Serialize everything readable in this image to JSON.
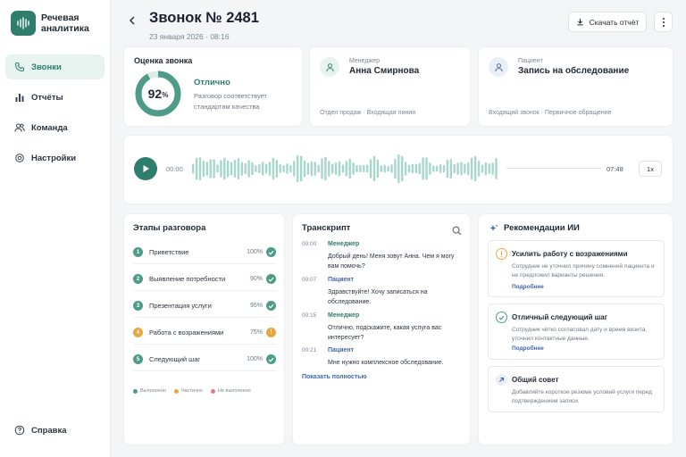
{
  "app": {
    "name": "Речевая аналитика"
  },
  "sidebar": {
    "items": [
      {
        "label": "Звонки",
        "icon": "phone-icon",
        "active": true
      },
      {
        "label": "Отчёты",
        "icon": "bar-chart-icon",
        "active": false
      },
      {
        "label": "Команда",
        "icon": "team-icon",
        "active": false
      },
      {
        "label": "Настройки",
        "icon": "gear-icon",
        "active": false
      }
    ],
    "help": {
      "label": "Справка",
      "icon": "help-icon"
    }
  },
  "header": {
    "title": "Звонок № 2481",
    "date": "23 января 2026 · 08:16",
    "download_label": "Скачать отчёт"
  },
  "score": {
    "title": "Оценка звонка",
    "value_number": "92",
    "value_unit": "%",
    "percent": 92,
    "label": "Отлично",
    "description": "Разговор соответствует стандартам качества"
  },
  "manager": {
    "role": "Менеджер",
    "name": "Анна Смирнова",
    "meta": "Отдел продаж · Входящая линия"
  },
  "patient": {
    "role": "Пациент",
    "name": "Запись на обследование",
    "meta": "Входящий звонок · Первичное обращение"
  },
  "player": {
    "current_time": "00:00",
    "duration": "07:48",
    "speed": "1x"
  },
  "stages": {
    "title": "Этапы разговора",
    "items": [
      {
        "num": "1",
        "label": "Приветствие",
        "percent": "100%",
        "status": "done"
      },
      {
        "num": "2",
        "label": "Выявление потребности",
        "percent": "90%",
        "status": "done"
      },
      {
        "num": "3",
        "label": "Презентация услуги",
        "percent": "95%",
        "status": "done"
      },
      {
        "num": "4",
        "label": "Работа с возражениями",
        "percent": "75%",
        "status": "partial"
      },
      {
        "num": "5",
        "label": "Следующий шаг",
        "percent": "100%",
        "status": "done"
      }
    ],
    "legend": [
      "Выполнено",
      "Частично",
      "Не выполнено"
    ]
  },
  "transcript": {
    "title": "Транскрипт",
    "messages": [
      {
        "time": "00:00",
        "speaker": "Менеджер",
        "text": "Добрый день! Меня зовут Анна. Чем я могу вам помочь?"
      },
      {
        "time": "00:07",
        "speaker": "Пациент",
        "text": "Здравствуйте! Хочу записаться на обследование."
      },
      {
        "time": "00:15",
        "speaker": "Менеджер",
        "text": "Отлично, подскажите, какая услуга вас интересует?"
      },
      {
        "time": "00:21",
        "speaker": "Пациент",
        "text": "Мне нужно комплексное обследование."
      }
    ],
    "show_all": "Показать полностью"
  },
  "recommendations": {
    "title": "Рекомендации ИИ",
    "items": [
      {
        "title": "Усилить работу с возражениями",
        "text": "Сотрудник не уточнил причину сомнений пациента и не предложил варианты решения.",
        "link": "Подробнее",
        "type": "warning"
      },
      {
        "title": "Отличный следующий шаг",
        "text": "Сотрудник чётко согласовал дату и время визита, уточнил контактные данные.",
        "link": "Подробнее",
        "type": "success"
      },
      {
        "title": "Общий совет",
        "text": "Добавляйте короткое резюме условий услуги перед подтверждением записи.",
        "link": "",
        "type": "info"
      }
    ]
  },
  "colors": {
    "accent": "#2f7d6d",
    "link": "#3f67a8",
    "warning": "#e6a740",
    "danger": "#e07a7a"
  }
}
